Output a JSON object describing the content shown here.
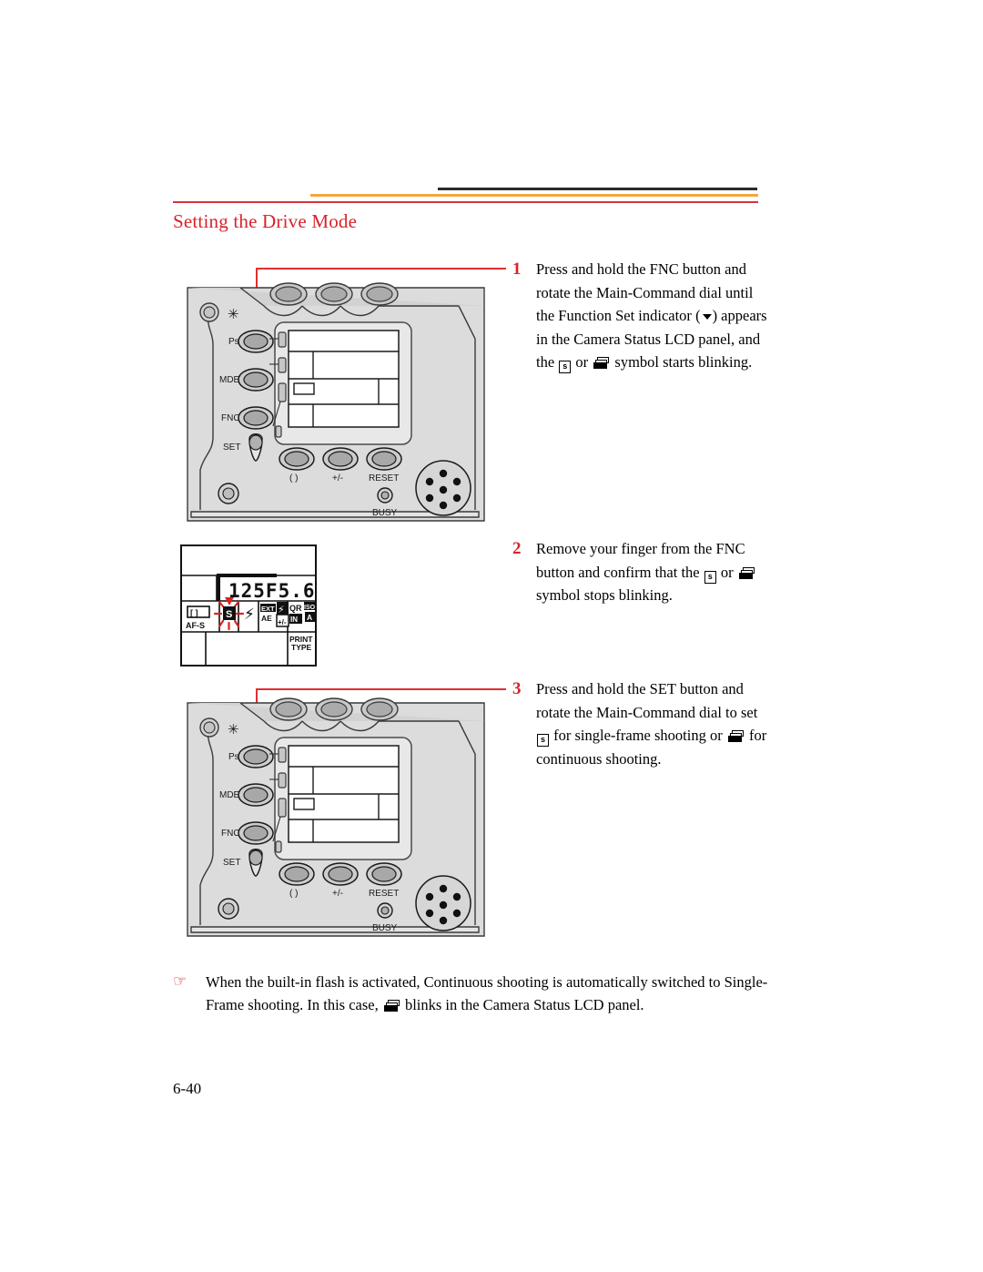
{
  "page": {
    "heading": "Setting the Drive Mode",
    "folio": "6-40"
  },
  "rules": {
    "black_color": "#2b2b2b",
    "orange_color": "#f5a642",
    "red_color": "#d8323c"
  },
  "colors": {
    "heading_red": "#d8232a",
    "callout_red": "#e03030",
    "note_bullet_red": "#cc1f24",
    "body_black": "#000000",
    "camera_body_fill": "#dcdcdc",
    "button_fill": "#b5b5b5",
    "lcd_fill": "#ffffff"
  },
  "steps": [
    {
      "number": "1",
      "lines": [
        "Press and hold the FNC button",
        "and rotate the Main-Command",
        "dial until the Function Set",
        "indicator ( ▾ ) appears in the",
        "Camera Status LCD panel, and",
        "the [S] or [continuous] symbol starts",
        "blinking."
      ],
      "text_part_1": "Press and hold the FNC button and rotate the Main-Command dial until the Function Set indicator",
      "text_part_2": ") appears in the Camera Status LCD panel, and the",
      "text_part_3": "or",
      "text_part_4": "symbol starts blinking.",
      "paren_open": "(",
      "paren_close": ")"
    },
    {
      "number": "2",
      "text_part_1": "Remove your finger from the FNC button and confirm that the",
      "text_part_2": "or",
      "text_part_3": "symbol stops blinking."
    },
    {
      "number": "3",
      "text_part_1": "Press and hold the SET button and rotate the Main-Command dial to set",
      "text_part_2": "for single-frame shooting or",
      "text_part_3": "for continuous shooting."
    }
  ],
  "glyphs": {
    "single_frame": "s",
    "continuous_label": "continuous-shooting-icon",
    "function_set_down": "function-set-down-arrow"
  },
  "camera": {
    "button_labels": {
      "ps": "Ps",
      "mde": "MDE",
      "fnc": "FNC",
      "set": "SET",
      "paren": "( )",
      "plusminus": "+/-",
      "reset": "RESET",
      "busy": "BUSY",
      "star": "✳"
    }
  },
  "status_lcd": {
    "shutter_speed": "125",
    "aperture_prefix": "F",
    "aperture": "5.6",
    "display_value": "125F5.6",
    "icons": {
      "af": "[ ]",
      "af_mode": "AF-S",
      "drive_single": "S",
      "flash": "☇",
      "ext": "EXT",
      "ae": "AE",
      "flash_comp_top": "☇",
      "flash_comp_bottom": "+/-",
      "qr": "QR",
      "in": "IN",
      "iso": "ISO",
      "iso_mode": "A",
      "print_line1": "PRINT",
      "print_line2": "TYPE"
    }
  },
  "note": {
    "bullet": "☞",
    "text": "When the built-in flash is activated, Continuous shooting is automatically switched to Single-Frame shooting. In this case,",
    "text_tail": "blinks in the Camera Status LCD panel."
  }
}
